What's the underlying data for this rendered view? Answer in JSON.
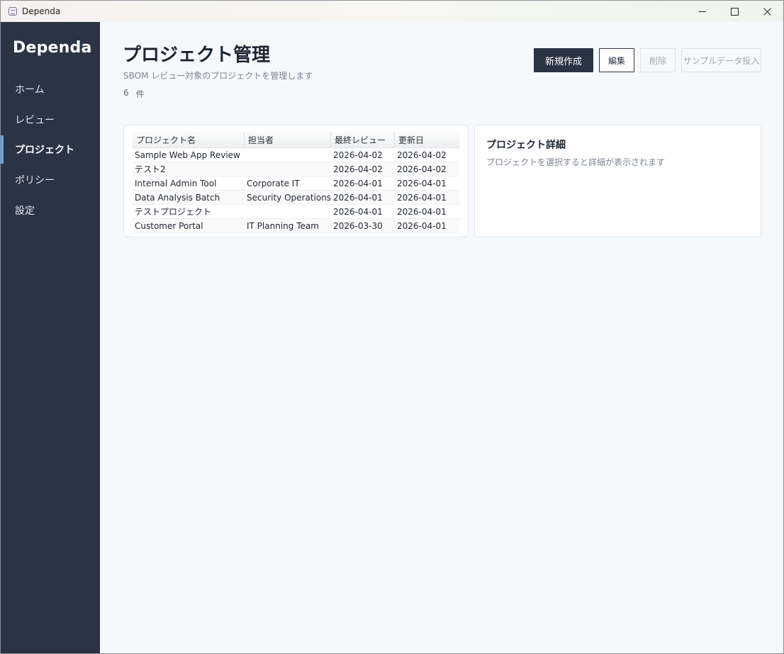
{
  "window": {
    "title": "Dependa"
  },
  "sidebar": {
    "brand": "Dependa",
    "items": [
      {
        "label": "ホーム"
      },
      {
        "label": "レビュー"
      },
      {
        "label": "プロジェクト",
        "active": true
      },
      {
        "label": "ポリシー"
      },
      {
        "label": "設定"
      }
    ]
  },
  "header": {
    "title": "プロジェクト管理",
    "subtitle": "SBOM レビュー対象のプロジェクトを管理します",
    "count": "6",
    "count_unit": "件"
  },
  "toolbar": {
    "new_label": "新規作成",
    "edit_label": "編集",
    "delete_label": "削除",
    "sample_label": "サンプルデータ投入"
  },
  "table": {
    "columns": [
      "プロジェクト名",
      "担当者",
      "最終レビュー",
      "更新日"
    ],
    "rows": [
      [
        "Sample Web App Review",
        "",
        "2026-04-02",
        "2026-04-02"
      ],
      [
        "テスト2",
        "",
        "2026-04-02",
        "2026-04-02"
      ],
      [
        "Internal Admin Tool",
        "Corporate IT",
        "2026-04-01",
        "2026-04-01"
      ],
      [
        "Data Analysis Batch",
        "Security Operations",
        "2026-04-01",
        "2026-04-01"
      ],
      [
        "テストプロジェクト",
        "",
        "2026-04-01",
        "2026-04-01"
      ],
      [
        "Customer Portal",
        "IT Planning Team",
        "2026-03-30",
        "2026-04-01"
      ]
    ]
  },
  "detail": {
    "title": "プロジェクト詳細",
    "hint": "プロジェクトを選択すると詳細が表示されます"
  },
  "colors": {
    "sidebar_bg": "#2b3445",
    "accent": "#6aa4d8",
    "page_bg": "#f5f9fc"
  },
  "icons": {
    "app": "app-icon",
    "minimize": "minimize-icon",
    "maximize": "maximize-icon",
    "close": "close-icon"
  }
}
